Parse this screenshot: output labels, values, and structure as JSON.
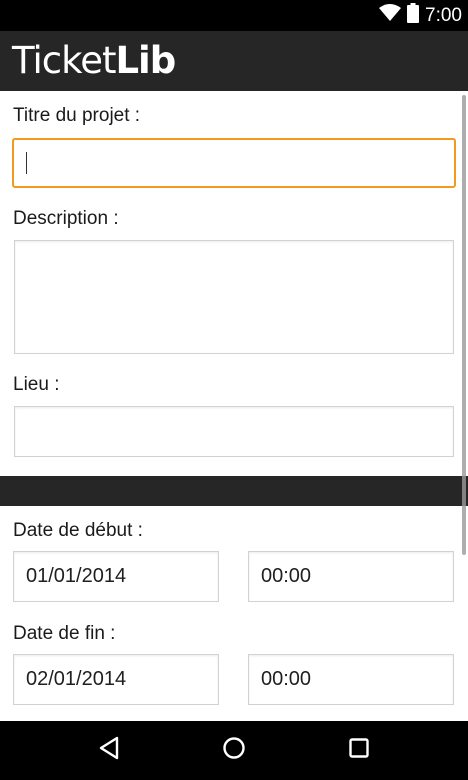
{
  "status_bar": {
    "time": "7:00",
    "icons": [
      "wifi-icon",
      "battery-icon"
    ]
  },
  "app_bar": {
    "title_light": "Ticket",
    "title_bold": "Lib"
  },
  "form": {
    "title_label": "Titre du projet :",
    "title_value": "",
    "description_label": "Description :",
    "description_value": "",
    "location_label": "Lieu :",
    "location_value": "",
    "start_label": "Date de début :",
    "start_date": "01/01/2014",
    "start_time": "00:00",
    "end_label": "Date de fin :",
    "end_date": "02/01/2014",
    "end_time": "00:00"
  },
  "nav_bar": {
    "buttons": [
      "back-icon",
      "home-icon",
      "recents-icon"
    ]
  },
  "colors": {
    "app_bar": "#262626",
    "focus_accent": "#f29a1f",
    "status_bar": "#000000"
  }
}
